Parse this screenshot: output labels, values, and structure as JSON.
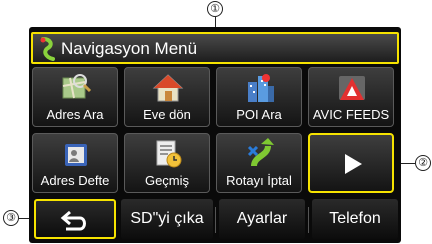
{
  "callouts": {
    "c1": "①",
    "c2": "②",
    "c3": "③"
  },
  "header": {
    "title": "Navigasyon Menü"
  },
  "grid": {
    "row1": [
      "Adres Ara",
      "Eve dön",
      "POI Ara",
      "AVIC FEEDS"
    ],
    "row2": [
      "Adres Defte",
      "Geçmiş",
      "Rotayı İptal"
    ]
  },
  "next_page_icon": "play-arrow-icon",
  "bottom": {
    "back_icon": "return-arrow-icon",
    "sd_label": "SD\"yi çıka",
    "settings_label": "Ayarlar",
    "phone_label": "Telefon"
  },
  "colors": {
    "highlight": "#f6e300",
    "background": "#0a0a0a"
  }
}
